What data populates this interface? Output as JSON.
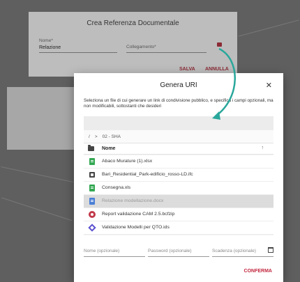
{
  "back_dialog": {
    "title": "Crea Referenza Documentale",
    "name_label": "Nome*",
    "name_value": "Relazione",
    "link_label": "Collegamento*",
    "save_label": "SALVA",
    "cancel_label": "ANNULLA"
  },
  "dialog": {
    "title": "Genera URI",
    "description": "Seleziona un file di cui generare un link di condivisione pubblico, e specifica i campi opzionali, ma non modificabili, sottostanti che desideri",
    "path": [
      "/",
      ">",
      "02 - SHA"
    ],
    "header_name": "Nome",
    "files": [
      {
        "name": "Abaco Murature (1).xlsx",
        "icon": "spreadsheet-icon",
        "color": "#34a853",
        "selected": false
      },
      {
        "name": "Bari_Residential_Park-edificio_rosso-LD.ifc",
        "icon": "ifc-model-icon",
        "color": "#444444",
        "selected": false
      },
      {
        "name": "Consegna.xls",
        "icon": "spreadsheet-icon",
        "color": "#34a853",
        "selected": false
      },
      {
        "name": "Relazione modellazione.docx",
        "icon": "document-icon",
        "color": "#4a7fd6",
        "selected": true
      },
      {
        "name": "Report validazione CAM 2.5.bcfzip",
        "icon": "bcf-icon",
        "color": "#c23a4b",
        "selected": false
      },
      {
        "name": "Validazione Modelli per QTO.ids",
        "icon": "ids-icon",
        "color": "#5a4fcf",
        "selected": false
      }
    ],
    "fields": {
      "name_placeholder": "Nome (opzionale)",
      "password_placeholder": "Password (opzionale)",
      "expiry_placeholder": "Scadenza (opzionale)"
    },
    "confirm_label": "CONFERMA"
  },
  "colors": {
    "accent": "#c2263e",
    "arrow": "#2aa79b",
    "selected_row": "#dcdcdc"
  }
}
